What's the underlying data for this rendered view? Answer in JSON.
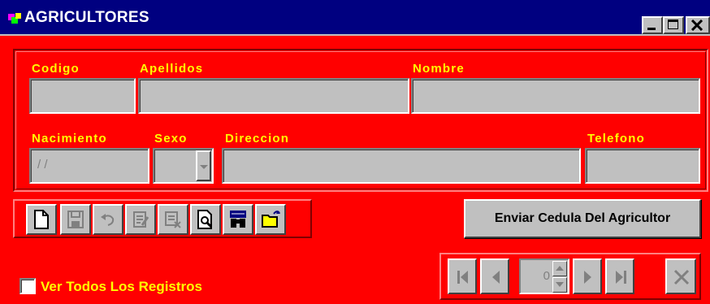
{
  "window": {
    "title": "AGRICULTORES",
    "icon": "app-icon"
  },
  "form": {
    "codigo": {
      "label": "Codigo",
      "value": ""
    },
    "apellidos": {
      "label": "Apellidos",
      "value": ""
    },
    "nombre": {
      "label": "Nombre",
      "value": ""
    },
    "nacimiento": {
      "label": "Nacimiento",
      "value": " / /"
    },
    "sexo": {
      "label": "Sexo",
      "value": ""
    },
    "direccion": {
      "label": "Direccion",
      "value": ""
    },
    "telefono": {
      "label": "Telefono",
      "value": ""
    }
  },
  "toolbar": {
    "buttons": [
      "new-icon",
      "save-icon",
      "undo-icon",
      "edit-icon",
      "delete-icon",
      "preview-icon",
      "find-icon",
      "open-folder-icon"
    ]
  },
  "actions": {
    "enviar_label": "Enviar Cedula Del Agricultor"
  },
  "options": {
    "ver_todos_label": "Ver Todos Los Registros",
    "ver_todos_checked": false
  },
  "navigator": {
    "record_number": "0",
    "buttons": [
      "first-record-icon",
      "previous-record-icon",
      "next-record-icon",
      "last-record-icon",
      "close-icon"
    ]
  },
  "colors": {
    "background": "#ff0000",
    "label": "#ffff00",
    "titlebar": "#000080",
    "control": "#c0c0c0"
  }
}
